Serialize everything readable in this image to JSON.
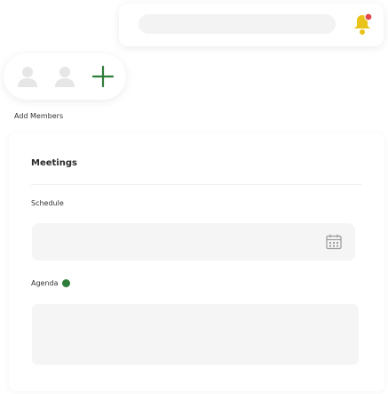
{
  "header": {
    "search_value": "",
    "bell_icon": "bell-icon",
    "bell_color": "#e9c31a",
    "bell_badge_color": "#e0484a"
  },
  "members": {
    "avatars": [
      "user-avatar-icon",
      "user-avatar-icon"
    ],
    "add_icon": "plus-icon",
    "add_color": "#2f7d3a",
    "label": "Add Members"
  },
  "meetings": {
    "title": "Meetings",
    "schedule_label": "Schedule",
    "schedule_value": "",
    "calendar_icon": "calendar-icon",
    "agenda_label": "Agenda",
    "agenda_dot_color": "#2f7d3a",
    "agenda_value": ""
  }
}
